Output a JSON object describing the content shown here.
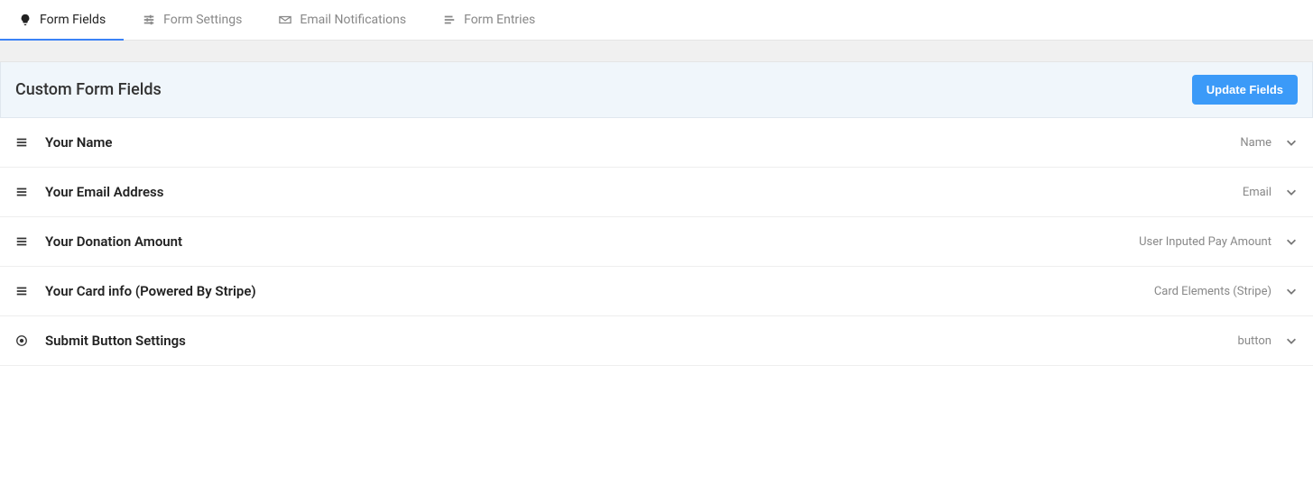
{
  "tabs": [
    {
      "label": "Form Fields",
      "icon": "bulb",
      "active": true
    },
    {
      "label": "Form Settings",
      "icon": "sliders",
      "active": false
    },
    {
      "label": "Email Notifications",
      "icon": "mail",
      "active": false
    },
    {
      "label": "Form Entries",
      "icon": "list",
      "active": false
    }
  ],
  "panel": {
    "title": "Custom Form Fields",
    "update_label": "Update Fields"
  },
  "fields": [
    {
      "label": "Your Name",
      "type": "Name",
      "draggable": true
    },
    {
      "label": "Your Email Address",
      "type": "Email",
      "draggable": true
    },
    {
      "label": "Your Donation Amount",
      "type": "User Inputed Pay Amount",
      "draggable": true
    },
    {
      "label": "Your Card info (Powered By Stripe)",
      "type": "Card Elements (Stripe)",
      "draggable": true
    },
    {
      "label": "Submit Button Settings",
      "type": "button",
      "draggable": false
    }
  ]
}
